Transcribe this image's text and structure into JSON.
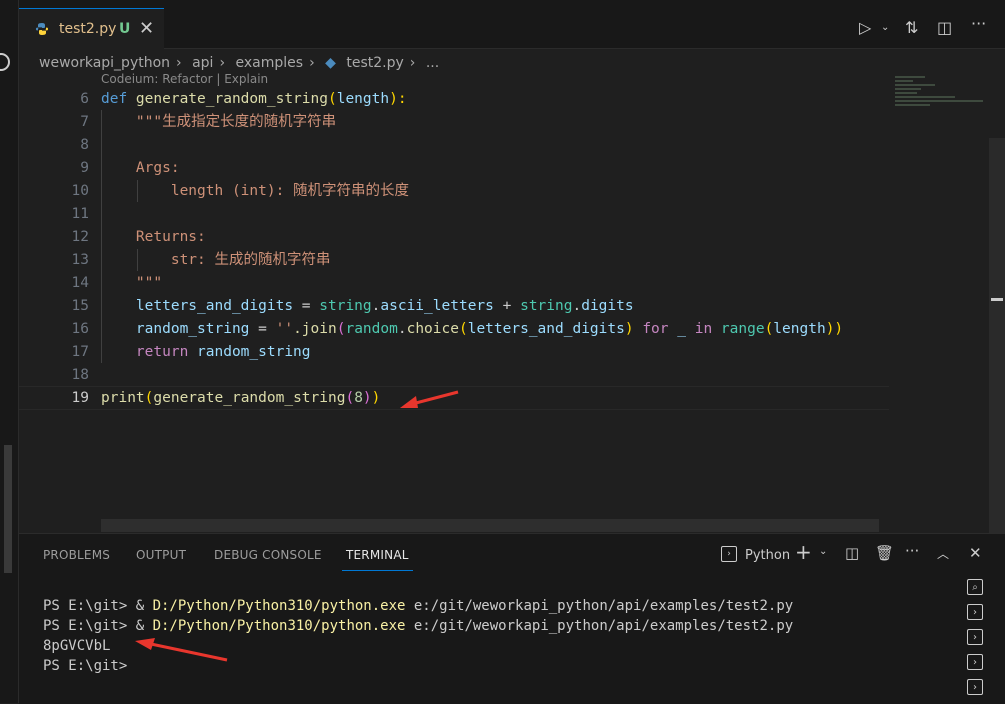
{
  "tab": {
    "filename": "test2.py",
    "status": "U"
  },
  "breadcrumb": [
    "weworkapi_python",
    "api",
    "examples",
    "test2.py",
    "..."
  ],
  "codelens": "Codeium: Refactor | Explain",
  "editor": {
    "current_line": "19",
    "lines": [
      {
        "no": "6",
        "tokens": [
          {
            "t": "def ",
            "c": "kw"
          },
          {
            "t": "generate_random_string",
            "c": "fn"
          },
          {
            "t": "(",
            "c": "br1"
          },
          {
            "t": "length",
            "c": "par"
          },
          {
            "t": "):",
            "c": "br1"
          }
        ]
      },
      {
        "no": "7",
        "tokens": [
          {
            "t": "    \"\"\"生成指定长度的随机字符串",
            "c": "str"
          }
        ]
      },
      {
        "no": "8",
        "tokens": []
      },
      {
        "no": "9",
        "tokens": [
          {
            "t": "    Args:",
            "c": "str"
          }
        ]
      },
      {
        "no": "10",
        "tokens": [
          {
            "t": "        length (int): 随机字符串的长度",
            "c": "str"
          }
        ]
      },
      {
        "no": "11",
        "tokens": []
      },
      {
        "no": "12",
        "tokens": [
          {
            "t": "    Returns:",
            "c": "str"
          }
        ]
      },
      {
        "no": "13",
        "tokens": [
          {
            "t": "        str: 生成的随机字符串",
            "c": "str"
          }
        ]
      },
      {
        "no": "14",
        "tokens": [
          {
            "t": "    \"\"\"",
            "c": "str"
          }
        ]
      },
      {
        "no": "15",
        "tokens": [
          {
            "t": "    letters_and_digits",
            "c": "par"
          },
          {
            "t": " = ",
            "c": "pl"
          },
          {
            "t": "string",
            "c": "cls"
          },
          {
            "t": ".",
            "c": "pl"
          },
          {
            "t": "ascii_letters",
            "c": "par"
          },
          {
            "t": " + ",
            "c": "pl"
          },
          {
            "t": "string",
            "c": "cls"
          },
          {
            "t": ".",
            "c": "pl"
          },
          {
            "t": "digits",
            "c": "par"
          }
        ]
      },
      {
        "no": "16",
        "tokens": [
          {
            "t": "    random_string",
            "c": "par"
          },
          {
            "t": " = ",
            "c": "pl"
          },
          {
            "t": "''",
            "c": "str"
          },
          {
            "t": ".join",
            "c": "fn"
          },
          {
            "t": "(",
            "c": "br2"
          },
          {
            "t": "random",
            "c": "cls"
          },
          {
            "t": ".",
            "c": "pl"
          },
          {
            "t": "choice",
            "c": "fn"
          },
          {
            "t": "(",
            "c": "br1"
          },
          {
            "t": "letters_and_digits",
            "c": "par"
          },
          {
            "t": ")",
            "c": "br1"
          },
          {
            "t": " for ",
            "c": "ctl"
          },
          {
            "t": "_",
            "c": "par"
          },
          {
            "t": " in ",
            "c": "ctl"
          },
          {
            "t": "range",
            "c": "cls"
          },
          {
            "t": "(",
            "c": "br1"
          },
          {
            "t": "length",
            "c": "par"
          },
          {
            "t": "))",
            "c": "br1"
          }
        ]
      },
      {
        "no": "17",
        "tokens": [
          {
            "t": "    return ",
            "c": "ctl"
          },
          {
            "t": "random_string",
            "c": "par"
          }
        ]
      },
      {
        "no": "18",
        "tokens": []
      },
      {
        "no": "19",
        "tokens": [
          {
            "t": "print",
            "c": "fn"
          },
          {
            "t": "(",
            "c": "br1"
          },
          {
            "t": "generate_random_string",
            "c": "fn"
          },
          {
            "t": "(",
            "c": "br2"
          },
          {
            "t": "8",
            "c": "num"
          },
          {
            "t": ")",
            "c": "br2"
          },
          {
            "t": ")",
            "c": "br1"
          }
        ]
      }
    ]
  },
  "panel": {
    "tabs": [
      "PROBLEMS",
      "OUTPUT",
      "DEBUG CONSOLE",
      "TERMINAL"
    ],
    "active_tab": "TERMINAL",
    "shell": "Python"
  },
  "terminal": {
    "prompt": "PS E:\\git> ",
    "exe": "D:/Python/Python310/python.exe",
    "script": " e:/git/weworkapi_python/api/examples/test2.py",
    "output": "8pGVCVbL"
  },
  "colors": {
    "accent": "#0078d4",
    "annotation_arrow": "#e8362d"
  }
}
